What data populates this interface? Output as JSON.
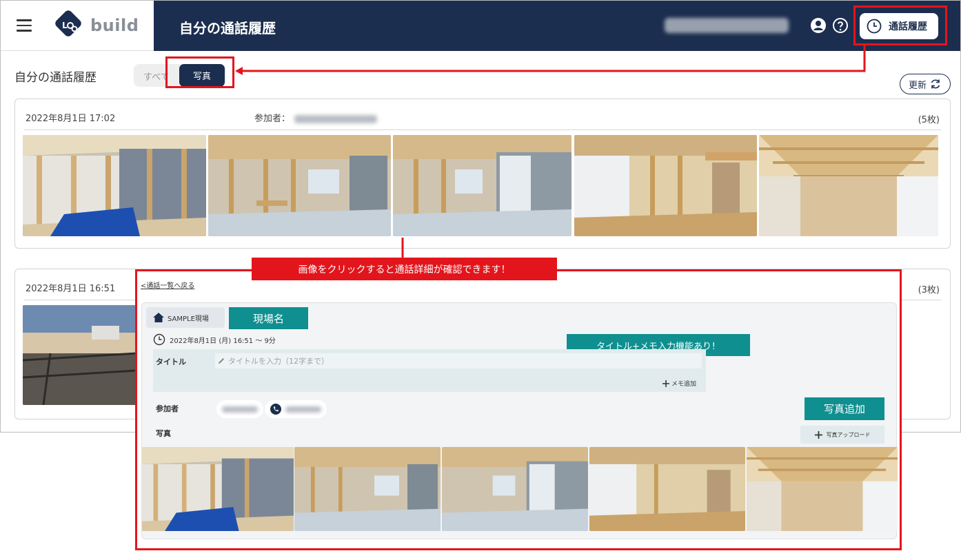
{
  "app": {
    "logo_text": "build",
    "page_title": "自分の通話履歴",
    "history_button_label": "通話履歴"
  },
  "subheader": {
    "title": "自分の通話履歴",
    "tabs": [
      {
        "label": "すべて",
        "active": false
      },
      {
        "label": "写真",
        "active": true
      }
    ],
    "refresh_label": "更新"
  },
  "calls": [
    {
      "datetime": "2022年8月1日 17:02",
      "participants_label": "参加者：",
      "count": "(5枚)",
      "photos": [
        "interior-framing-left-wall",
        "framing-window-room",
        "framing-window-room",
        "framing-window-stairs",
        "ceiling-framing"
      ]
    },
    {
      "datetime": "2022年8月1日 16:51",
      "count": "(3枚)",
      "photos": [
        "outdoor-foundation-site"
      ]
    }
  ],
  "callout": {
    "text": "画像をクリックすると通話詳細が確認できます！"
  },
  "detail": {
    "back_link": "<通話一覧へ戻る",
    "site_name": "SAMPLE現場",
    "site_note": "現場名",
    "datetime": "2022年8月1日 (月) 16:51 ～ 9分",
    "feature_note": "タイトル+メモ入力機能あり！",
    "title_label": "タイトル",
    "title_placeholder": "タイトルを入力（12字まで）",
    "memo_add": "メモ追加",
    "participants_label": "参加者",
    "photo_add_note": "写真追加",
    "photos_label": "写真",
    "upload_label": "写真アップロード",
    "photos": [
      "interior-framing-left-wall",
      "framing-window-room",
      "framing-window-room",
      "framing-window-stairs",
      "ceiling-framing"
    ]
  },
  "colors": {
    "navy": "#1c2e4f",
    "highlight_red": "#e3151c",
    "note_teal": "#0f8f8f"
  }
}
